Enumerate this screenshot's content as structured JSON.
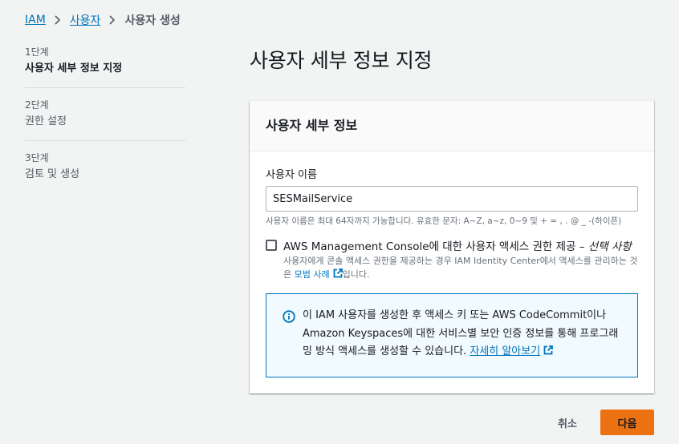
{
  "breadcrumb": {
    "items": [
      "IAM",
      "사용자"
    ],
    "current": "사용자 생성"
  },
  "steps": [
    {
      "num": "1단계",
      "title": "사용자 세부 정보 지정"
    },
    {
      "num": "2단계",
      "title": "권한 설정"
    },
    {
      "num": "3단계",
      "title": "검토 및 생성"
    }
  ],
  "page": {
    "title": "사용자 세부 정보 지정"
  },
  "container": {
    "header": "사용자 세부 정보",
    "username_label": "사용자 이름",
    "username_value": "SESMailService",
    "constraint": "사용자 이름은 최대 64자까지 가능합니다. 유효한 문자: A~Z, a~z, 0~9 및 + = , . @ _ -(하이픈)",
    "console_access": {
      "label_main": "AWS Management Console에 대한 사용자 액세스 권한 제공 – ",
      "label_optional": "선택 사항",
      "desc_main": "사용자에게 콘솔 액세스 권한을 제공하는 경우 IAM Identity Center에서 액세스를 관리하는 것은 ",
      "desc_link": "모범 사례",
      "desc_end": "입니다."
    },
    "info": {
      "text": "이 IAM 사용자를 생성한 후 액세스 키 또는 AWS CodeCommit이나 Amazon Keyspaces에 대한 서비스별 보안 인증 정보를 통해 프로그래밍 방식 액세스를 생성할 수 있습니다. ",
      "link": "자세히 알아보기"
    }
  },
  "footer": {
    "cancel": "취소",
    "next": "다음"
  },
  "colors": {
    "link": "#0073bb",
    "primary_button": "#ec7211",
    "info_bg": "#f1faff"
  }
}
